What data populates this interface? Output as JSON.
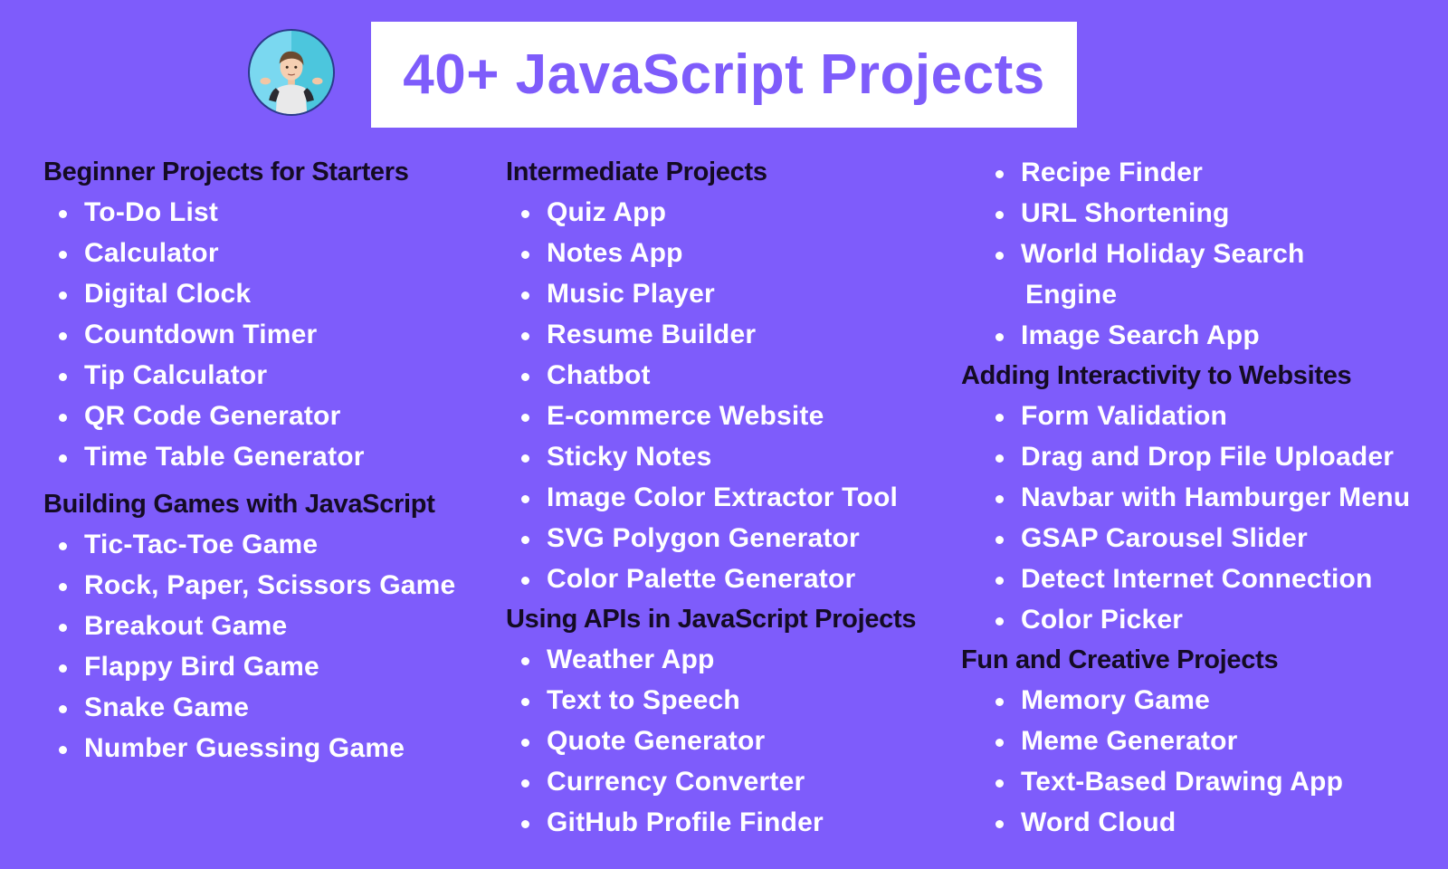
{
  "header": {
    "avatar_icon": "memoji-shrug-avatar",
    "title": "40+ JavaScript Projects"
  },
  "colors": {
    "background": "#7e5cfb",
    "title_text": "#7e5cfb",
    "title_box": "#ffffff",
    "section_heading": "#140b24",
    "item_text": "#ffffff"
  },
  "columns": [
    {
      "sections": [
        {
          "heading": "Beginner Projects for Starters",
          "items": [
            "To-Do List",
            "Calculator",
            "Digital Clock",
            "Countdown Timer",
            "Tip Calculator",
            "QR Code Generator",
            "Time Table Generator"
          ]
        },
        {
          "heading": "Building Games with JavaScript",
          "items": [
            "Tic-Tac-Toe Game",
            "Rock, Paper, Scissors Game",
            "Breakout Game",
            "Flappy Bird Game",
            "Snake Game",
            "Number Guessing Game"
          ]
        }
      ]
    },
    {
      "sections": [
        {
          "heading": "Intermediate Projects",
          "items": [
            "Quiz App",
            "Notes App",
            "Music Player",
            "Resume Builder",
            "Chatbot",
            "E-commerce Website",
            "Sticky Notes",
            "Image Color Extractor Tool",
            "SVG Polygon Generator",
            "Color Palette Generator"
          ]
        },
        {
          "heading": "Using APIs in JavaScript Projects",
          "items": [
            "Weather App",
            "Text to Speech",
            "Quote Generator",
            "Currency Converter",
            "GitHub Profile Finder"
          ]
        }
      ]
    },
    {
      "continued_items": [
        "Recipe Finder",
        "URL Shortening",
        "World Holiday Search",
        "Image Search App"
      ],
      "continued_wrap": "Engine",
      "sections": [
        {
          "heading": "Adding Interactivity to Websites",
          "items": [
            "Form Validation",
            "Drag and Drop File Uploader",
            "Navbar with Hamburger Menu",
            "GSAP Carousel Slider",
            "Detect Internet Connection",
            "Color Picker"
          ]
        },
        {
          "heading": "Fun and Creative Projects",
          "items": [
            "Memory Game",
            "Meme Generator",
            "Text-Based Drawing App",
            "Word Cloud"
          ]
        }
      ]
    }
  ]
}
